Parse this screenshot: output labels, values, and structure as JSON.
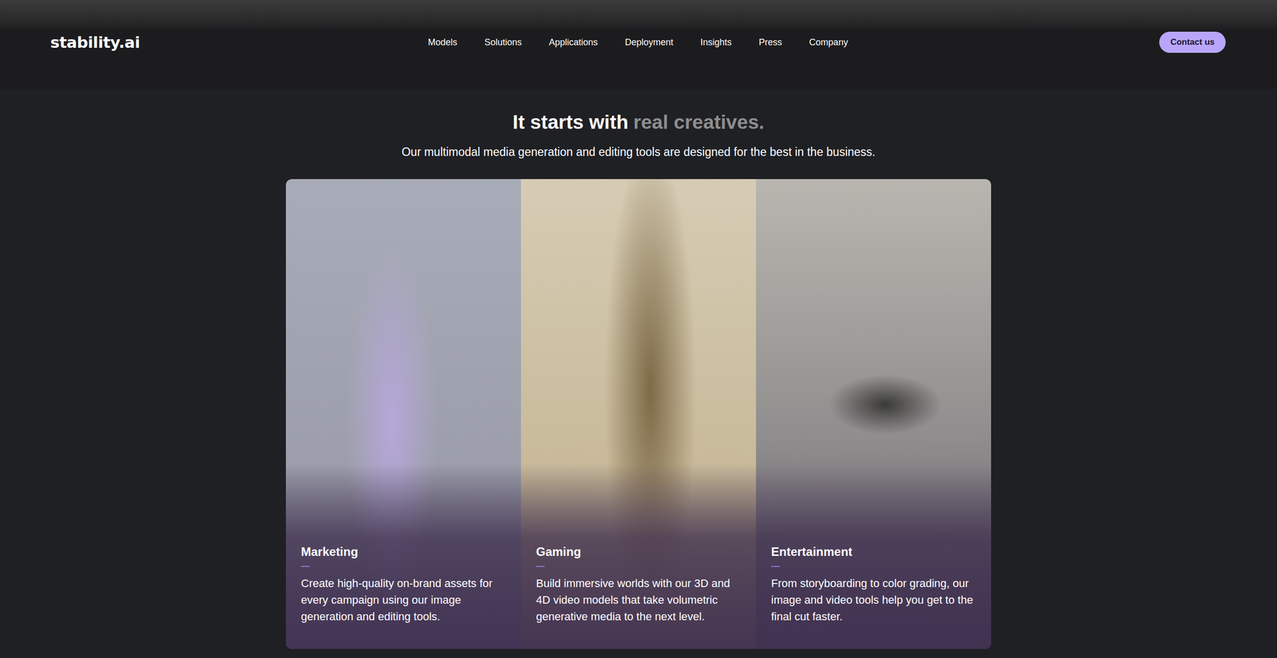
{
  "nav": {
    "logo": "stability.ai",
    "items": [
      "Models",
      "Solutions",
      "Applications",
      "Deployment",
      "Insights",
      "Press",
      "Company"
    ],
    "cta": "Contact us"
  },
  "hero": {
    "title": "It starts with",
    "title_accent": "real creatives.",
    "subtitle": "Our multimodal media generation and editing tools are designed for the best in the business."
  },
  "cards": [
    {
      "title": "Marketing",
      "description": "Create high-quality on-brand assets for every campaign using our image generation and editing tools."
    },
    {
      "title": "Gaming",
      "description": "Build immersive worlds with our 3D and 4D video models that take volumetric generative media to the next level."
    },
    {
      "title": "Entertainment",
      "description": "From storyboarding to color grading, our image and video tools help you get to the final cut faster."
    }
  ]
}
